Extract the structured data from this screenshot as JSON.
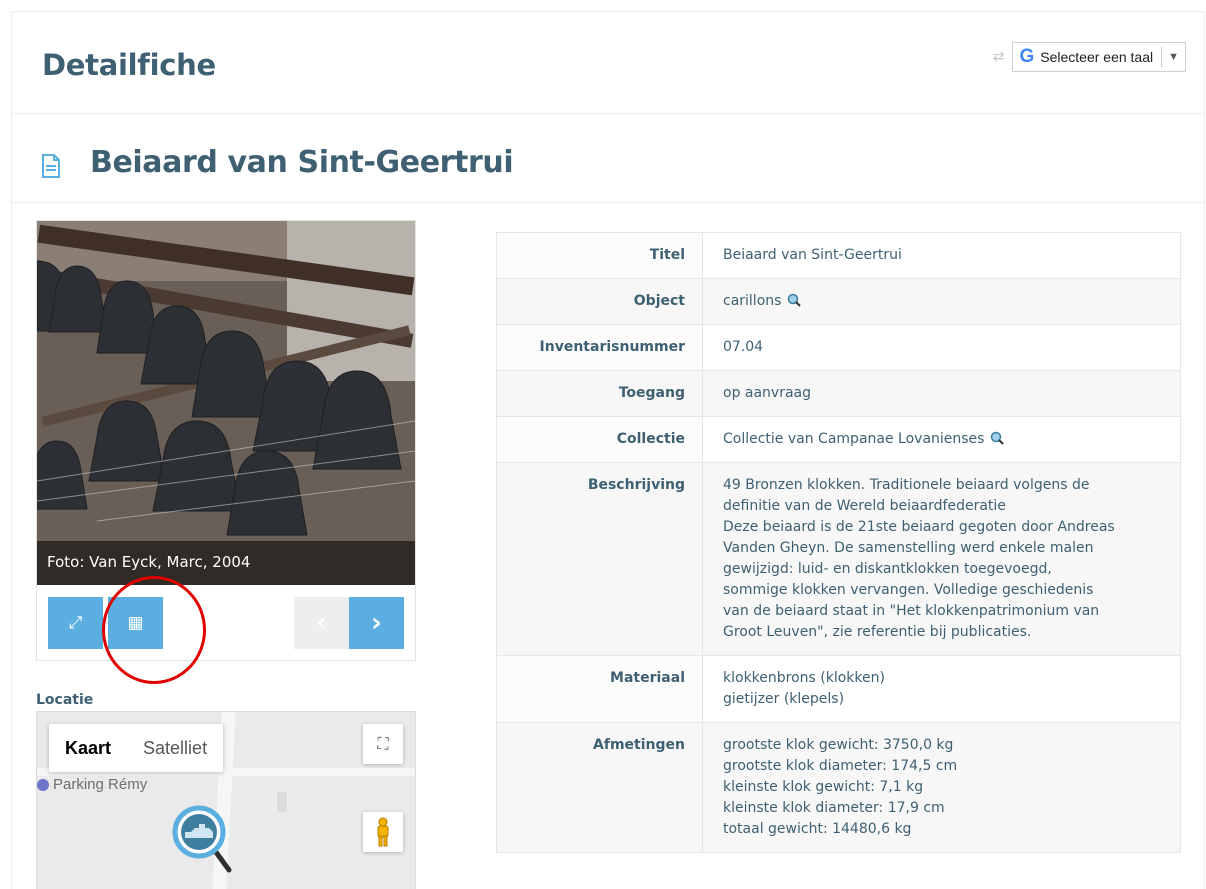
{
  "header": {
    "title": "Detailfiche",
    "translate": {
      "label": "Selecteer een taal",
      "logo": "G",
      "arrow": "▼",
      "swap": "⇄"
    }
  },
  "record": {
    "title": "Beiaard van Sint-Geertrui",
    "photo_caption": "Foto: Van Eyck, Marc, 2004",
    "fields": [
      {
        "key": "Titel",
        "value": [
          "Beiaard van Sint-Geertrui"
        ]
      },
      {
        "key": "Object",
        "value": [
          "carillons"
        ]
      },
      {
        "key": "Inventarisnummer",
        "value": [
          "07.04"
        ]
      },
      {
        "key": "Toegang",
        "value": [
          "op aanvraag"
        ]
      },
      {
        "key": "Collectie",
        "value": [
          "Collectie van Campanae Lovanienses"
        ]
      },
      {
        "key": "Beschrijving",
        "value": [
          "49 Bronzen klokken. Traditionele beiaard volgens de",
          "definitie van de Wereld beiaardfederatie",
          "Deze beiaard is de 21ste beiaard gegoten door Andreas",
          "Vanden Gheyn. De samenstelling werd enkele malen",
          "gewijzigd: luid- en diskantklokken toegevoegd,",
          "sommige klokken vervangen. Volledige geschiedenis",
          "van de beiaard staat in \"Het klokkenpatrimonium van",
          "Groot Leuven\", zie referentie bij publicaties."
        ]
      },
      {
        "key": "Materiaal",
        "value": [
          "klokkenbrons (klokken)",
          "gietijzer (klepels)"
        ]
      },
      {
        "key": "Afmetingen",
        "value": [
          "grootste klok gewicht: 3750,0 kg",
          "grootste klok diameter: 174,5 cm",
          "kleinste klok gewicht: 7,1 kg",
          "kleinste klok diameter: 17,9 cm",
          "totaal gewicht: 14480,6 kg"
        ]
      }
    ]
  },
  "gallery_controls": {
    "expand_icon": "⤢",
    "grid_icon": "▦",
    "prev_icon": "‹",
    "next_icon": "›"
  },
  "location": {
    "label": "Locatie",
    "map": {
      "tab_map": "Kaart",
      "tab_satellite": "Satelliet",
      "poi": "Parking Rémy",
      "fullscreen_icon": "⛶"
    }
  },
  "colors": {
    "heading": "#3e6072",
    "button": "#5aaee0",
    "highlight": "#e00000"
  }
}
